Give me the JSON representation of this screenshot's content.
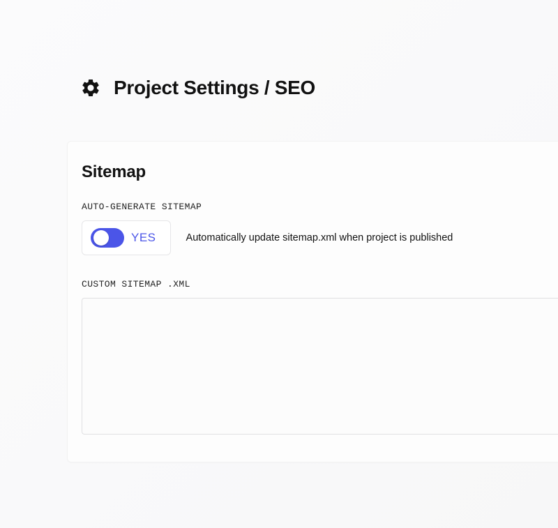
{
  "header": {
    "title": "Project Settings / SEO"
  },
  "panel": {
    "section_title": "Sitemap",
    "auto_generate": {
      "label": "AUTO-GENERATE SITEMAP",
      "toggle_state": "YES",
      "description": "Automatically update sitemap.xml when project is published"
    },
    "custom_sitemap": {
      "label": "CUSTOM SITEMAP .XML",
      "value": ""
    }
  }
}
